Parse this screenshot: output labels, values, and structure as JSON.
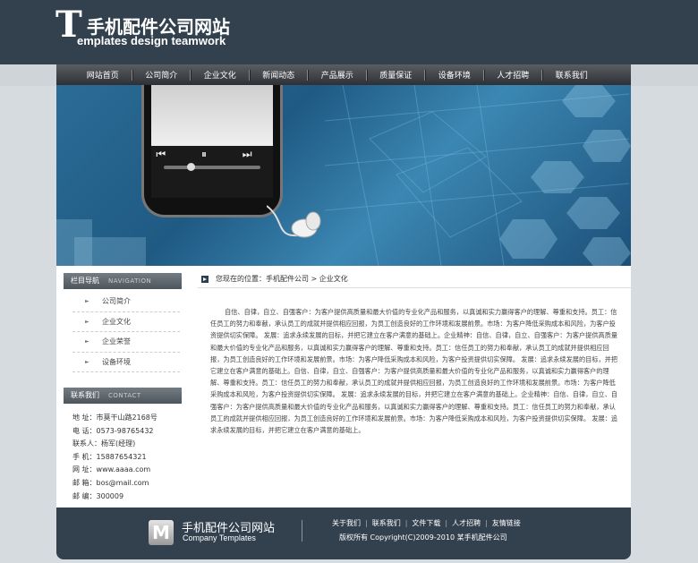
{
  "header": {
    "logo_letter": "T",
    "logo_cn": "手机配件公司网站",
    "logo_en": "emplates design teamwork"
  },
  "nav": {
    "items": [
      "网站首页",
      "公司简介",
      "企业文化",
      "新闻动态",
      "产品展示",
      "质量保证",
      "设备环境",
      "人才招聘",
      "联系我们"
    ]
  },
  "banner": {
    "controls": "⏮ ⏸ ⏭"
  },
  "sidebar": {
    "nav_heading": "栏目导航",
    "nav_heading_en": "NAVIGATION",
    "menu": [
      "公司简介",
      "企业文化",
      "企业荣誉",
      "设备环境"
    ],
    "contact_heading": "联系我们",
    "contact_heading_en": "CONTACT",
    "contact": [
      "地  址：市莫干山路2168号",
      "电  话：0573-98765432",
      "联系人：杨军(经理)",
      "手  机：15887654321",
      "网  址：www.aaaa.com",
      "邮  箱：bos@mail.com",
      "邮  编：300009"
    ]
  },
  "content": {
    "breadcrumb": "您现在的位置：手机配件公司 > 企业文化",
    "article": "自信、自律，自立、自强客户：为客户提供高质量和最大价值的专业化产品和服务，以真诚和实力赢得客户的理解、尊重和支持。员工：信任员工的努力和奉献，承认员工的成就并提供相应回报，为员工创造良好的工作环境和发展前景。市场：为客户降低采购成本和风险，为客户投资提供切实保障。 发展：追求永续发展的目标，并把它建立在客户满意的基础上。企业精神：自信、自律，自立、自强客户：为客户提供高质量和最大价值的专业化产品和服务，以真诚和实力赢得客户的理解、尊重和支持。员工：信任员工的努力和奉献，承认员工的成就并提供相应回报，为员工创造良好的工作环境和发展前景。市场：为客户降低采购成本和风险，为客户投资提供切实保障。 发展：追求永续发展的目标，并把它建立在客户满意的基础上。自信、自律，自立、自强客户：为客户提供高质量和最大价值的专业化产品和服务，以真诚和实力赢得客户的理解、尊重和支持。员工：信任员工的努力和奉献，承认员工的成就并提供相应回报，为员工创造良好的工作环境和发展前景。市场：为客户降低采购成本和风险，为客户投资提供切实保障。 发展：追求永续发展的目标，并把它建立在客户满意的基础上。企业精神：自信、自律，自立、自强客户：为客户提供高质量和最大价值的专业化产品和服务，以真诚和实力赢得客户的理解、尊重和支持。员工：信任员工的努力和奉献，承认员工的成就并提供相应回报，为员工创造良好的工作环境和发展前景。市场：为客户降低采购成本和风险，为客户投资提供切实保障。 发展：追求永续发展的目标，并把它建立在客户满意的基础上。"
  },
  "footer": {
    "logo_letter": "M",
    "title": "手机配件公司网站",
    "subtitle": "Company Templates",
    "links": [
      "关于我们",
      "联系我们",
      "文件下载",
      "人才招聘",
      "友情链接"
    ],
    "copyright": "版权所有 Copyright(C)2009-2010 某手机配件公司"
  },
  "colors": {
    "header_bg": "#33414f",
    "page_bg": "#d6dbe0",
    "banner_blue": "#2b6c95"
  }
}
